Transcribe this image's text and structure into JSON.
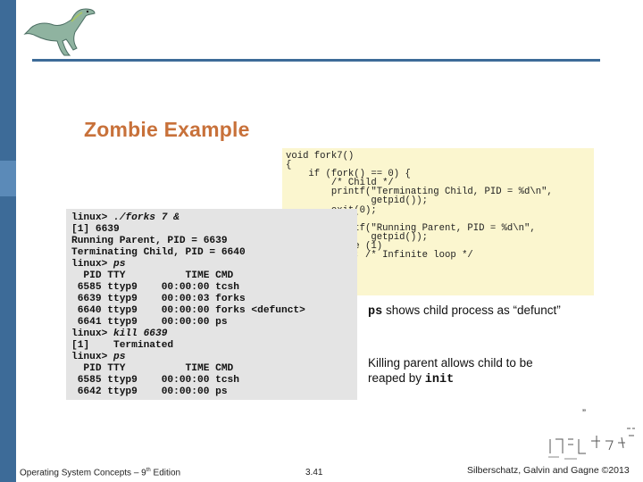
{
  "title": "Zombie Example",
  "code_lines": [
    "void fork7()",
    "{",
    "    if (fork() == 0) {",
    "        /* Child */",
    "        printf(\"Terminating Child, PID = %d\\n\",",
    "               getpid());",
    "        exit(0);",
    "    } else {",
    "        printf(\"Running Parent, PID = %d\\n\",",
    "               getpid());",
    "        while (1)",
    "            ; /* Infinite loop */",
    "    }",
    "}"
  ],
  "terminal_lines": [
    {
      "text": "linux> ",
      "cmd": "./forks 7 &"
    },
    {
      "text": "[1] 6639",
      "cmd": ""
    },
    {
      "text": "Running Parent, PID = 6639",
      "cmd": ""
    },
    {
      "text": "Terminating Child, PID = 6640",
      "cmd": ""
    },
    {
      "text": "linux> ",
      "cmd": "ps"
    },
    {
      "text": "  PID TTY          TIME CMD",
      "cmd": ""
    },
    {
      "text": " 6585 ttyp9    00:00:00 tcsh",
      "cmd": ""
    },
    {
      "text": " 6639 ttyp9    00:00:03 forks",
      "cmd": ""
    },
    {
      "text": " 6640 ttyp9    00:00:00 forks <defunct>",
      "cmd": ""
    },
    {
      "text": " 6641 ttyp9    00:00:00 ps",
      "cmd": ""
    },
    {
      "text": "linux> ",
      "cmd": "kill 6639"
    },
    {
      "text": "[1]    Terminated",
      "cmd": ""
    },
    {
      "text": "linux> ",
      "cmd": "ps"
    },
    {
      "text": "  PID TTY          TIME CMD",
      "cmd": ""
    },
    {
      "text": " 6585 ttyp9    00:00:00 tcsh",
      "cmd": ""
    },
    {
      "text": " 6642 ttyp9    00:00:00 ps",
      "cmd": ""
    }
  ],
  "caption_ps": {
    "mono": "ps",
    "rest": " shows child process as “defunct”"
  },
  "caption_kill": {
    "line1": "Killing parent allows child to be",
    "line2_prefix": "reaped by ",
    "line2_mono": "init"
  },
  "quote_mark": "”",
  "footer": {
    "left_prefix": "Operating System Concepts – 9",
    "left_sup": "th",
    "left_suffix": " Edition",
    "page": "3.41",
    "copyright": "Silberschatz, Galvin and Gagne ©2013"
  },
  "colors": {
    "accent_blue": "#3d6b98",
    "title_orange": "#c8713a",
    "code_bg": "#fbf6cf",
    "terminal_bg": "#e4e4e4"
  },
  "icons": {
    "logo": "dinosaur-logo-icon"
  }
}
